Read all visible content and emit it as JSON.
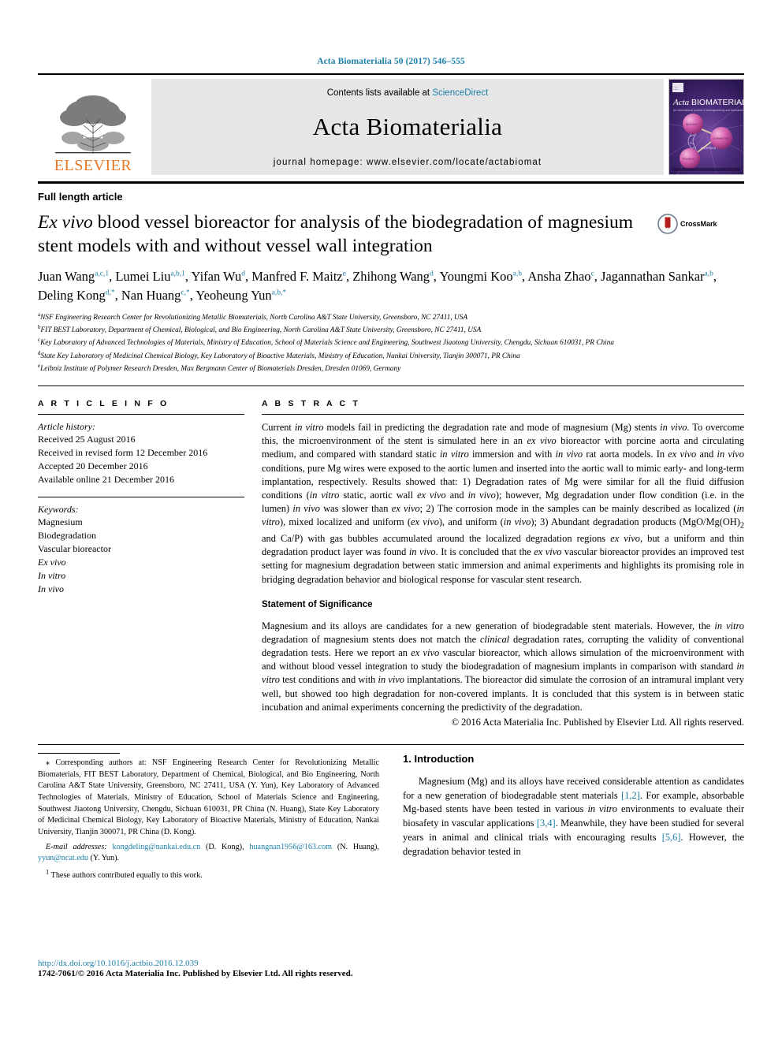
{
  "running_head": "Acta Biomaterialia 50 (2017) 546–555",
  "masthead": {
    "publisher_name": "ELSEVIER",
    "contents_prefix": "Contents lists available at ",
    "sciencedirect": "ScienceDirect",
    "journal_name": "Acta Biomaterialia",
    "homepage": "journal homepage: www.elsevier.com/locate/actabiomat",
    "cover_title_italic": "Acta",
    "cover_title_rest": "BIOMATERIALIA",
    "cover_subtitle": "An international journal of bioengineering and biomaterials"
  },
  "article": {
    "type": "Full length article",
    "title_part1": "Ex vivo",
    "title_part2": " blood vessel bioreactor for analysis of the biodegradation of magnesium stent models with and without vessel wall integration",
    "crossmark_label": "CrossMark"
  },
  "authors": [
    {
      "name": "Juan Wang",
      "sup": "a,c,1",
      "sep": ", "
    },
    {
      "name": "Lumei Liu",
      "sup": "a,b,1",
      "sep": ", "
    },
    {
      "name": "Yifan Wu",
      "sup": "d",
      "sep": ", "
    },
    {
      "name": "Manfred F. Maitz",
      "sup": "e",
      "sep": ", "
    },
    {
      "name": "Zhihong Wang",
      "sup": "d",
      "sep": ", "
    },
    {
      "name": "Youngmi Koo",
      "sup": "a,b",
      "sep": ", "
    },
    {
      "name": "Ansha Zhao",
      "sup": "c",
      "sep": ", "
    },
    {
      "name": "Jagannathan Sankar",
      "sup": "a,b",
      "sep": ", "
    },
    {
      "name": "Deling Kong",
      "sup": "d,*",
      "sep": ", "
    },
    {
      "name": "Nan Huang",
      "sup": "c,*",
      "sep": ", "
    },
    {
      "name": "Yeoheung Yun",
      "sup": "a,b,*",
      "sep": ""
    }
  ],
  "affiliations": [
    {
      "key": "a",
      "text": "NSF Engineering Research Center for Revolutionizing Metallic Biomaterials, North Carolina A&T State University, Greensboro, NC 27411, USA"
    },
    {
      "key": "b",
      "text": "FIT BEST Laboratory, Department of Chemical, Biological, and Bio Engineering, North Carolina A&T State University, Greensboro, NC 27411, USA"
    },
    {
      "key": "c",
      "text": "Key Laboratory of Advanced Technologies of Materials, Ministry of Education, School of Materials Science and Engineering, Southwest Jiaotong University, Chengdu, Sichuan 610031, PR China"
    },
    {
      "key": "d",
      "text": "State Key Laboratory of Medicinal Chemical Biology, Key Laboratory of Bioactive Materials, Ministry of Education, Nankai University, Tianjin 300071, PR China"
    },
    {
      "key": "e",
      "text": "Leibniz Institute of Polymer Research Dresden, Max Bergmann Center of Biomaterials Dresden, Dresden 01069, Germany"
    }
  ],
  "article_info": {
    "heading": "A R T I C L E  I N F O",
    "history_label": "Article history:",
    "history": [
      "Received 25 August 2016",
      "Received in revised form 12 December 2016",
      "Accepted 20 December 2016",
      "Available online 21 December 2016"
    ],
    "keywords_label": "Keywords:",
    "keywords": [
      {
        "text": "Magnesium",
        "italic": false
      },
      {
        "text": "Biodegradation",
        "italic": false
      },
      {
        "text": "Vascular bioreactor",
        "italic": false
      },
      {
        "text": "Ex vivo",
        "italic": true
      },
      {
        "text": "In vitro",
        "italic": true
      },
      {
        "text": "In vivo",
        "italic": true
      }
    ]
  },
  "abstract": {
    "heading": "A B S T R A C T",
    "body_html": "Current <em>in vitro</em> models fail in predicting the degradation rate and mode of magnesium (Mg) stents <em>in vivo</em>. To overcome this, the microenvironment of the stent is simulated here in an <em>ex vivo</em> bioreactor with porcine aorta and circulating medium, and compared with standard static <em>in vitro</em> immersion and with <em>in vivo</em> rat aorta models. In <em>ex vivo</em> and <em>in vivo</em> conditions, pure Mg wires were exposed to the aortic lumen and inserted into the aortic wall to mimic early- and long-term implantation, respectively. Results showed that: 1) Degradation rates of Mg were similar for all the fluid diffusion conditions (<em>in vitro</em> static, aortic wall <em>ex vivo</em> and <em>in vivo</em>); however, Mg degradation under flow condition (i.e. in the lumen) <em>in vivo</em> was slower than <em>ex vivo</em>; 2) The corrosion mode in the samples can be mainly described as localized (<em>in vitro</em>), mixed localized and uniform (<em>ex vivo</em>), and uniform (<em>in vivo</em>); 3) Abundant degradation products (MgO/Mg(OH)<sub>2</sub> and Ca/P) with gas bubbles accumulated around the localized degradation regions <em>ex vivo</em>, but a uniform and thin degradation product layer was found <em>in vivo</em>. It is concluded that the <em>ex vivo</em> vascular bioreactor provides an improved test setting for magnesium degradation between static immersion and animal experiments and highlights its promising role in bridging degradation behavior and biological response for vascular stent research.",
    "significance_heading": "Statement of Significance",
    "significance_html": "Magnesium and its alloys are candidates for a new generation of biodegradable stent materials. However, the <em>in vitro</em> degradation of magnesium stents does not match the <em>clinical</em> degradation rates, corrupting the validity of conventional degradation tests. Here we report an <em>ex vivo</em> vascular bioreactor, which allows simulation of the microenvironment with and without blood vessel integration to study the biodegradation of magnesium implants in comparison with standard <em>in vitro</em> test conditions and with <em>in vivo</em> implantations. The bioreactor did simulate the corrosion of an intramural implant very well, but showed too high degradation for non-covered implants. It is concluded that this system is in between static incubation and animal experiments concerning the predictivity of the degradation.",
    "copyright": "© 2016 Acta Materialia Inc. Published by Elsevier Ltd. All rights reserved."
  },
  "footnotes": {
    "corresponding_html": "<span class=\"lead\">⁎ Corresponding authors at: NSF Engineering Research Center for Revolutionizing Metallic Biomaterials, FIT BEST Laboratory, Department of Chemical, Biological, and Bio Engineering, North Carolina A&amp;T State University, Greensboro, NC 27411, USA (Y. Yun), Key Laboratory of Advanced Technologies of Materials, Ministry of Education, School of Materials Science and Engineering, Southwest Jiaotong University, Chengdu, Sichuan 610031, PR China (N. Huang), State Key Laboratory of Medicinal Chemical Biology, Key Laboratory of Bioactive Materials, Ministry of Education, Nankai University, Tianjin 300071, PR China (D. Kong).</span>",
    "email_label": "E-mail addresses:",
    "emails": [
      {
        "address": "kongdeling@nankai.edu.cn",
        "owner": "(D. Kong)"
      },
      {
        "address": "huangnan1956@163.com",
        "owner": "(N. Huang)"
      },
      {
        "address": "yyun@ncat.edu",
        "owner": "(Y. Yun)"
      }
    ],
    "equal_contribution": "These authors contributed equally to this work.",
    "equal_marker": "1"
  },
  "introduction": {
    "heading": "1. Introduction",
    "paragraph_html": "Magnesium (Mg) and its alloys have received considerable attention as candidates for a new generation of biodegradable stent materials <span class=\"link\">[1,2]</span>. For example, absorbable Mg-based stents have been tested in various <em>in vitro</em> environments to evaluate their biosafety in vascular applications <span class=\"link\">[3,4]</span>. Meanwhile, they have been studied for several years in animal and clinical trials with encouraging results <span class=\"link\">[5,6]</span>. However, the degradation behavior tested in"
  },
  "footer": {
    "doi": "http://dx.doi.org/10.1016/j.actbio.2016.12.039",
    "issn_line": "1742-7061/© 2016 Acta Materialia Inc. Published by Elsevier Ltd. All rights reserved."
  },
  "colors": {
    "link": "#1a7fa8",
    "elsevier_orange": "#e87722",
    "masthead_bg": "#e6e6e6"
  }
}
